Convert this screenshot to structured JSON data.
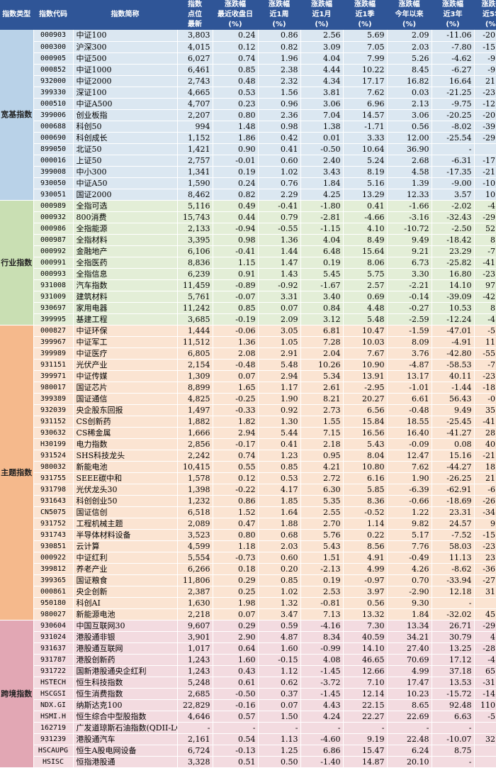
{
  "header": {
    "category": "指数类型",
    "code": "指数代码",
    "name": "指数简称",
    "points": [
      "指数",
      "点位",
      "最新"
    ],
    "cols": [
      [
        "涨跌幅",
        "最近收盘日",
        "(%)"
      ],
      [
        "涨跌幅",
        "近1周",
        "(%)"
      ],
      [
        "涨跌幅",
        "近1月",
        "(%)"
      ],
      [
        "涨跌幅",
        "近1季",
        "(%)"
      ],
      [
        "涨跌幅",
        "今年以来",
        "(%)"
      ],
      [
        "涨跌幅",
        "近3年",
        "(%)"
      ],
      [
        "涨跌幅",
        "近5年",
        "(%)"
      ]
    ]
  },
  "groups": [
    {
      "key": "kuan",
      "label": "宽基指数",
      "rows": [
        [
          "000903",
          "中证100",
          "3,803",
          "0.24",
          "0.86",
          "2.56",
          "5.69",
          "2.09",
          "-11.06",
          "-20.24"
        ],
        [
          "000300",
          "沪深300",
          "4,015",
          "0.12",
          "0.82",
          "3.09",
          "7.05",
          "2.03",
          "-7.80",
          "-15.53"
        ],
        [
          "000905",
          "中证500",
          "6,027",
          "0.74",
          "1.96",
          "4.04",
          "7.99",
          "5.26",
          "-4.62",
          "-9.73"
        ],
        [
          "000852",
          "中证1000",
          "6,461",
          "0.85",
          "2.38",
          "4.44",
          "10.22",
          "8.45",
          "-6.27",
          "-9.64"
        ],
        [
          "932000",
          "中证2000",
          "2,743",
          "0.48",
          "2.32",
          "4.34",
          "17.17",
          "16.82",
          "16.64",
          "21.23"
        ],
        [
          "399330",
          "深证100",
          "4,665",
          "0.53",
          "1.56",
          "3.81",
          "7.62",
          "0.03",
          "-21.25",
          "-23.02"
        ],
        [
          "000510",
          "中证A500",
          "4,707",
          "0.23",
          "0.96",
          "3.06",
          "6.96",
          "2.13",
          "-9.75",
          "-12.94"
        ],
        [
          "399006",
          "创业板指",
          "2,207",
          "0.80",
          "2.36",
          "7.04",
          "14.57",
          "3.06",
          "-20.25",
          "-20.56"
        ],
        [
          "000688",
          "科创50",
          "994",
          "1.48",
          "0.98",
          "1.38",
          "-1.71",
          "0.56",
          "-8.02",
          "-39.91"
        ],
        [
          "000690",
          "科创成长",
          "1,152",
          "1.86",
          "0.42",
          "0.01",
          "3.33",
          "12.00",
          "-25.54",
          "-29.66"
        ],
        [
          "899050",
          "北证50",
          "1,421",
          "0.90",
          "0.41",
          "-0.50",
          "10.64",
          "36.90",
          "-",
          "-"
        ],
        [
          "000016",
          "上证50",
          "2,757",
          "-0.01",
          "0.60",
          "2.40",
          "5.24",
          "2.68",
          "-6.31",
          "-17.75"
        ],
        [
          "399008",
          "中小300",
          "1,341",
          "0.19",
          "1.02",
          "3.43",
          "8.19",
          "4.58",
          "-17.35",
          "-21.75"
        ],
        [
          "930050",
          "中证A50",
          "1,590",
          "0.24",
          "0.76",
          "1.84",
          "5.16",
          "1.39",
          "-9.00",
          "-10.95"
        ],
        [
          "930051",
          "国证2000",
          "8,462",
          "0.82",
          "2.29",
          "4.25",
          "13.29",
          "12.33",
          "3.57",
          "10.05"
        ]
      ]
    },
    {
      "key": "hang",
      "label": "行业指数",
      "rows": [
        [
          "000989",
          "全指可选",
          "5,116",
          "0.49",
          "-0.41",
          "-1.80",
          "0.41",
          "-1.66",
          "-2.02",
          "-4.72"
        ],
        [
          "000932",
          "800消费",
          "15,743",
          "0.44",
          "0.79",
          "-2.81",
          "-4.66",
          "-3.16",
          "-32.43",
          "-29.40"
        ],
        [
          "000986",
          "全指能源",
          "2,133",
          "-0.94",
          "-0.55",
          "-1.15",
          "4.10",
          "-10.72",
          "-2.50",
          "52.16"
        ],
        [
          "000987",
          "全指材料",
          "3,395",
          "0.98",
          "1.36",
          "4.04",
          "8.49",
          "9.49",
          "-18.42",
          "8.57"
        ],
        [
          "000992",
          "金融地产",
          "6,106",
          "-0.41",
          "1.44",
          "6.48",
          "15.64",
          "9.21",
          "23.29",
          "-7.18"
        ],
        [
          "000991",
          "全指医药",
          "8,836",
          "1.15",
          "1.47",
          "0.19",
          "8.06",
          "6.73",
          "-25.82",
          "-41.35"
        ],
        [
          "000993",
          "全指信息",
          "6,239",
          "0.91",
          "1.43",
          "5.45",
          "5.75",
          "3.30",
          "16.80",
          "-23.79"
        ],
        [
          "931008",
          "汽车指数",
          "11,459",
          "-0.89",
          "-0.92",
          "-1.67",
          "2.57",
          "-2.21",
          "14.10",
          "97.20"
        ],
        [
          "931009",
          "建筑材料",
          "5,761",
          "-0.07",
          "3.31",
          "3.40",
          "0.69",
          "-0.14",
          "-39.09",
          "-42.73"
        ],
        [
          "930697",
          "家用电器",
          "11,242",
          "0.85",
          "0.07",
          "0.84",
          "4.48",
          "-0.27",
          "10.53",
          "8.18"
        ],
        [
          "399995",
          "基建工程",
          "3,685",
          "-0.19",
          "2.09",
          "3.12",
          "5.48",
          "-2.59",
          "-12.24",
          "-4.04"
        ]
      ]
    },
    {
      "key": "zhu",
      "label": "主题指数",
      "rows": [
        [
          "000827",
          "中证环保",
          "1,444",
          "-0.06",
          "3.05",
          "6.81",
          "10.47",
          "-1.59",
          "-47.01",
          "-5.31"
        ],
        [
          "399967",
          "中证军工",
          "11,512",
          "1.36",
          "1.05",
          "7.28",
          "10.03",
          "8.09",
          "-4.91",
          "11.65"
        ],
        [
          "399989",
          "中证医疗",
          "6,805",
          "2.08",
          "2.91",
          "2.04",
          "7.67",
          "3.76",
          "-42.80",
          "-55.99"
        ],
        [
          "931151",
          "光伏产业",
          "2,154",
          "-0.48",
          "5.48",
          "10.26",
          "10.90",
          "-4.87",
          "-58.53",
          "-7.38"
        ],
        [
          "399971",
          "中证传媒",
          "1,309",
          "0.07",
          "2.94",
          "5.34",
          "13.91",
          "13.17",
          "40.11",
          "-23.66"
        ],
        [
          "980017",
          "国证芯片",
          "8,899",
          "1.65",
          "1.17",
          "2.61",
          "-2.95",
          "-1.01",
          "-1.44",
          "-18.22"
        ],
        [
          "399389",
          "国证通信",
          "4,825",
          "-0.25",
          "1.90",
          "8.21",
          "20.27",
          "6.61",
          "56.43",
          "-0.76"
        ],
        [
          "932039",
          "央企股东回报",
          "1,497",
          "-0.33",
          "0.92",
          "2.73",
          "6.56",
          "-0.48",
          "9.49",
          "35.95"
        ],
        [
          "931152",
          "CS创新药",
          "1,882",
          "1.82",
          "1.30",
          "1.55",
          "15.84",
          "18.55",
          "-25.45",
          "-41.41"
        ],
        [
          "930632",
          "CS稀金属",
          "1,666",
          "2.94",
          "5.44",
          "7.15",
          "16.56",
          "16.40",
          "-41.27",
          "28.69"
        ],
        [
          "H30199",
          "电力指数",
          "2,856",
          "-0.17",
          "0.41",
          "2.18",
          "5.43",
          "-0.09",
          "0.08",
          "40.65"
        ],
        [
          "931524",
          "SHS科技龙头",
          "2,242",
          "0.74",
          "1.23",
          "0.95",
          "8.04",
          "12.47",
          "15.16",
          "-21.34"
        ],
        [
          "980032",
          "新能电池",
          "10,415",
          "0.55",
          "0.85",
          "4.21",
          "10.80",
          "7.62",
          "-44.27",
          "18.08"
        ],
        [
          "931755",
          "SEEE碳中和",
          "1,578",
          "0.12",
          "0.53",
          "2.72",
          "6.16",
          "1.90",
          "-26.25",
          "21.13"
        ],
        [
          "931798",
          "光伏龙头30",
          "1,398",
          "-0.22",
          "4.17",
          "6.30",
          "5.85",
          "-6.39",
          "-62.91",
          "-6.41"
        ],
        [
          "931643",
          "科创创业50",
          "1,232",
          "0.86",
          "1.85",
          "5.35",
          "8.36",
          "-0.66",
          "-18.69",
          "-26.35"
        ],
        [
          "CN5075",
          "国证信创",
          "6,518",
          "1.52",
          "1.64",
          "2.55",
          "-0.52",
          "1.22",
          "23.31",
          "-34.47"
        ],
        [
          "931752",
          "工程机械主题",
          "2,089",
          "0.47",
          "1.88",
          "2.70",
          "1.14",
          "9.82",
          "24.57",
          "9.69"
        ],
        [
          "931743",
          "半导体材料设备",
          "3,523",
          "0.80",
          "0.68",
          "5.76",
          "0.22",
          "5.17",
          "-7.52",
          "-15.54"
        ],
        [
          "930851",
          "云计算",
          "4,599",
          "1.18",
          "2.03",
          "5.43",
          "8.56",
          "7.76",
          "58.03",
          "-23.05"
        ],
        [
          "000922",
          "中证红利",
          "5,554",
          "-0.73",
          "0.60",
          "1.51",
          "4.91",
          "-0.49",
          "11.13",
          "23.76"
        ],
        [
          "399812",
          "养老产业",
          "6,266",
          "0.18",
          "0.20",
          "-2.13",
          "4.99",
          "4.26",
          "-8.62",
          "-36.51"
        ],
        [
          "399365",
          "国证粮食",
          "11,806",
          "0.29",
          "0.85",
          "0.19",
          "-0.97",
          "0.70",
          "-33.94",
          "-27.28"
        ],
        [
          "000861",
          "央企创新",
          "2,387",
          "0.25",
          "1.02",
          "2.53",
          "3.97",
          "-2.90",
          "12.18",
          "31.38"
        ],
        [
          "950180",
          "科创AI",
          "1,630",
          "1.98",
          "1.32",
          "-0.81",
          "0.56",
          "9.30",
          "-",
          "-"
        ],
        [
          "980027",
          "新能源电池",
          "2,218",
          "0.07",
          "3.47",
          "7.13",
          "13.32",
          "1.84",
          "-32.02",
          "45.18"
        ]
      ]
    },
    {
      "key": "kua",
      "label": "跨境指数",
      "rows": [
        [
          "930604",
          "中国互联网30",
          "9,607",
          "0.29",
          "0.59",
          "-4.16",
          "7.30",
          "13.34",
          "26.71",
          "-29.55"
        ],
        [
          "931024",
          "港股通非银",
          "3,901",
          "2.90",
          "4.87",
          "8.34",
          "40.59",
          "34.21",
          "30.79",
          "4.60"
        ],
        [
          "931637",
          "港股通互联网",
          "1,017",
          "0.64",
          "1.60",
          "-0.99",
          "14.10",
          "27.40",
          "13.25",
          "-28.88"
        ],
        [
          "931787",
          "港股创新药",
          "1,243",
          "1.60",
          "-0.15",
          "4.08",
          "46.65",
          "70.69",
          "17.12",
          "-4.90"
        ],
        [
          "931722",
          "国新港股通央企红利",
          "1,243",
          "0.43",
          "1.12",
          "-1.45",
          "12.66",
          "4.99",
          "37.18",
          "65.32"
        ],
        [
          "HSTECH",
          "恒生科技指数",
          "5,248",
          "0.61",
          "0.62",
          "-3.72",
          "7.10",
          "17.47",
          "13.53",
          "-31.70"
        ],
        [
          "HSCGSI",
          "恒生消费指数",
          "2,685",
          "-0.50",
          "0.37",
          "-1.45",
          "12.14",
          "10.23",
          "-15.72",
          "-14.45"
        ],
        [
          "NDX.GI",
          "纳斯达克100",
          "22,829",
          "-0.16",
          "0.07",
          "4.43",
          "22.15",
          "8.65",
          "92.48",
          "110.67"
        ],
        [
          "HSMI.H",
          "恒生综合中型股指数",
          "4,646",
          "0.57",
          "1.50",
          "4.24",
          "22.27",
          "22.69",
          "6.63",
          "-5.25"
        ],
        [
          "162719",
          "广发道琼斯石油指数(QDII-LOF)",
          "-",
          "-",
          "-",
          "-",
          "-",
          "-",
          "-",
          "-"
        ],
        [
          "931239",
          "港股通汽车",
          "2,161",
          "0.54",
          "1.13",
          "-4.60",
          "9.19",
          "22.48",
          "-10.07",
          "32.61"
        ],
        [
          "HSCAUPG",
          "恒生A股电网设备",
          "6,724",
          "-0.13",
          "1.25",
          "6.86",
          "15.47",
          "6.24",
          "8.75",
          "-"
        ],
        [
          "HSISC",
          "恒指港股通",
          "3,328",
          "0.51",
          "0.50",
          "-1.40",
          "14.87",
          "20.10",
          "-",
          "-"
        ]
      ]
    }
  ]
}
